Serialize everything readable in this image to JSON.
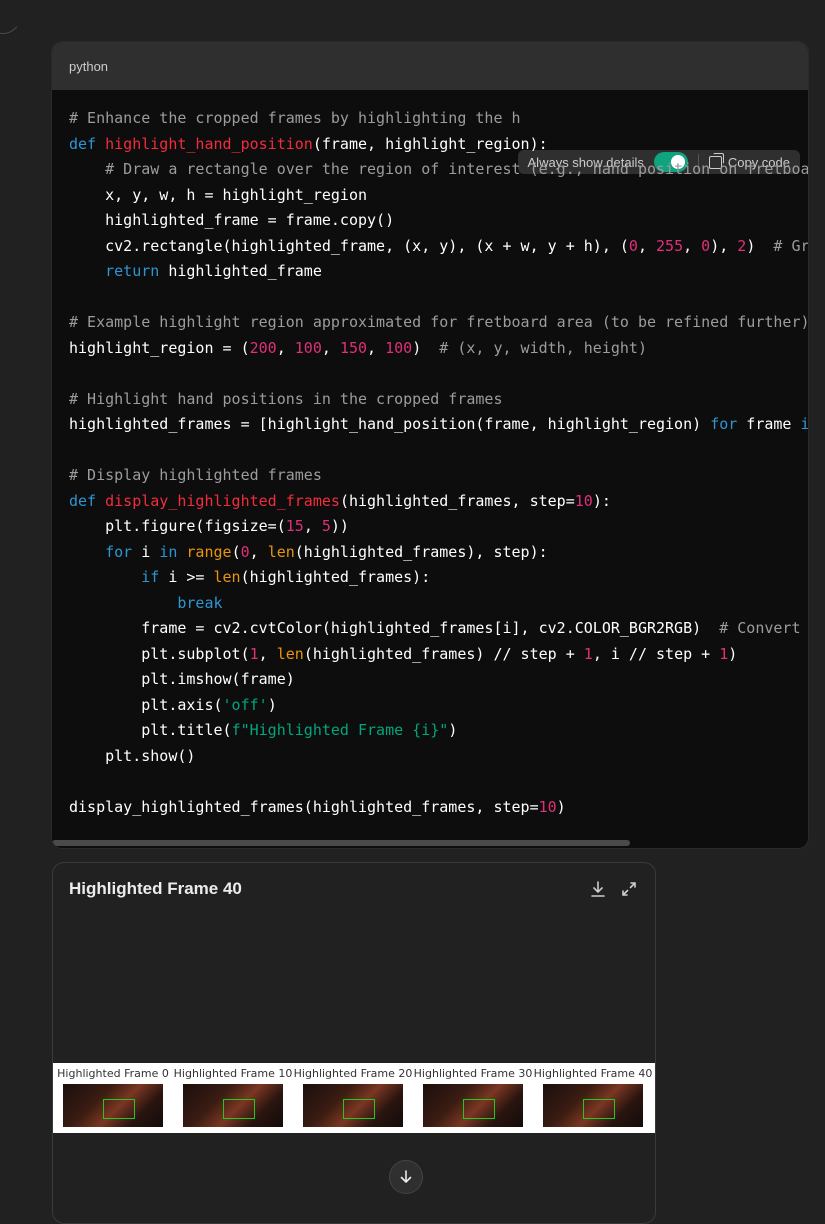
{
  "code_block": {
    "language": "python",
    "toolbar": {
      "toggle_label": "Always show details",
      "copy_label": "Copy code"
    }
  },
  "image_card": {
    "title": "Highlighted Frame 40",
    "frames": [
      "Highlighted Frame 0",
      "Highlighted Frame 10",
      "Highlighted Frame 20",
      "Highlighted Frame 30",
      "Highlighted Frame 40"
    ]
  },
  "icons": [
    "download-icon",
    "expand-icon",
    "copy-icon",
    "arrow-down-icon"
  ],
  "colors": {
    "toggle_on": "#10a37f",
    "frame_highlight": "#22c922"
  }
}
